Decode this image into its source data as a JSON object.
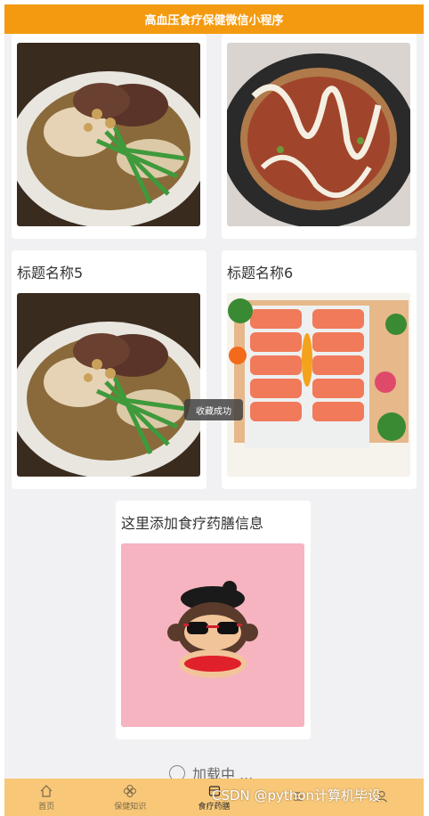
{
  "header": {
    "title": "高血压食疗保健微信小程序"
  },
  "cards": [
    {
      "title": "",
      "image": "braised-beef-noodle-soup"
    },
    {
      "title": "",
      "image": "okonomiyaki-pancake"
    },
    {
      "title": "标题名称5",
      "image": "braised-beef-noodle-soup"
    },
    {
      "title": "标题名称6",
      "image": "salmon-sashimi-platter"
    },
    {
      "title": "这里添加食疗药膳信息",
      "image": "monkey-cartoon"
    }
  ],
  "toast": {
    "text": "收藏成功"
  },
  "loading": {
    "text": "加载中 ..."
  },
  "tabbar": {
    "items": [
      {
        "label": "首页",
        "icon": "home-icon"
      },
      {
        "label": "保健知识",
        "icon": "flower-icon"
      },
      {
        "label": "食疗药膳",
        "icon": "bowl-icon"
      },
      {
        "label": "",
        "icon": "list-icon"
      },
      {
        "label": "",
        "icon": "user-icon"
      }
    ],
    "active_index": 2
  },
  "watermark": {
    "text": "CSDN @python计算机毕设"
  }
}
